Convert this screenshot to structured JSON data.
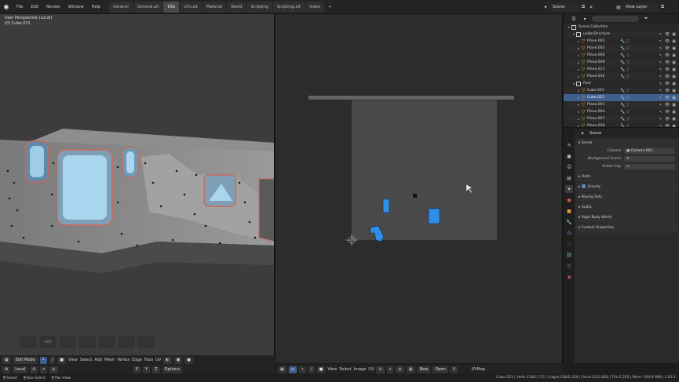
{
  "topbar": {
    "menus": [
      "File",
      "Edit",
      "Render",
      "Window",
      "Help"
    ],
    "workspaces": [
      "General",
      "General.alt",
      "UVs",
      "UVs.alt",
      "Material",
      "World",
      "Scripting",
      "Scripting.alt",
      "Video"
    ],
    "active_workspace_index": 2,
    "add_tab": "+",
    "scene_label": "Scene",
    "view_layer_label": "View Layer"
  },
  "viewport3d": {
    "view_label": "User Perspective (Local)",
    "object_label": "(0) Cube.021",
    "ghost_button_label": "shift",
    "header": {
      "mode": "Edit Mode",
      "menus": [
        "View",
        "Select",
        "Add",
        "Mesh",
        "Vertex",
        "Edge",
        "Face",
        "UV"
      ],
      "orientation": "Local",
      "options": "Options"
    }
  },
  "uveditor": {
    "header": {
      "menus": [
        "View",
        "Select",
        "Image",
        "UV"
      ],
      "new": "New",
      "open": "Open",
      "uvmap": "UVMap"
    }
  },
  "outliner": {
    "rows": [
      {
        "name": "Scene Collection",
        "kind": "scene",
        "indent": 0
      },
      {
        "name": "underStructure",
        "kind": "collection",
        "indent": 1
      },
      {
        "name": "Plane.003",
        "kind": "object",
        "indent": 2
      },
      {
        "name": "Plane.005",
        "kind": "object",
        "indent": 2
      },
      {
        "name": "Plane.006",
        "kind": "object",
        "indent": 2
      },
      {
        "name": "Plane.009",
        "kind": "object",
        "indent": 2
      },
      {
        "name": "Plane.015",
        "kind": "object",
        "indent": 2
      },
      {
        "name": "Plane.016",
        "kind": "object",
        "indent": 2
      },
      {
        "name": "floor",
        "kind": "collection",
        "indent": 1
      },
      {
        "name": "Cube.001",
        "kind": "object",
        "indent": 2
      },
      {
        "name": "Cube.021",
        "kind": "object",
        "indent": 2,
        "selected": true
      },
      {
        "name": "Plane.001",
        "kind": "object",
        "indent": 2
      },
      {
        "name": "Plane.004",
        "kind": "object",
        "indent": 2
      },
      {
        "name": "Plane.007",
        "kind": "object",
        "indent": 2
      },
      {
        "name": "Plane.008",
        "kind": "object",
        "indent": 2
      }
    ]
  },
  "properties": {
    "breadcrumb": "Scene",
    "scene_panel": "Scene",
    "camera_label": "Camera",
    "camera_value": "Camera.001",
    "background_scene_label": "Background Scene",
    "active_clip_label": "Active Clip",
    "units": "Units",
    "gravity": "Gravity",
    "keying_sets": "Keying Sets",
    "audio": "Audio",
    "rigid_body_world": "Rigid Body World",
    "custom_properties": "Custom Properties"
  },
  "statusbar": {
    "select": "Select",
    "box_select": "Box Select",
    "pan_view": "Pan View",
    "stats": "Cube.021 | Verts:118/2,715 | Edges:128/5,334 | Faces:22/2,620 | Tris:5,352 | Mem: 204.8 MiB | 2.83.1"
  },
  "colors": {
    "accent_blue": "#3f5f8f",
    "uv_island": "#2f8fe8",
    "object_orange": "#e89a3c"
  }
}
